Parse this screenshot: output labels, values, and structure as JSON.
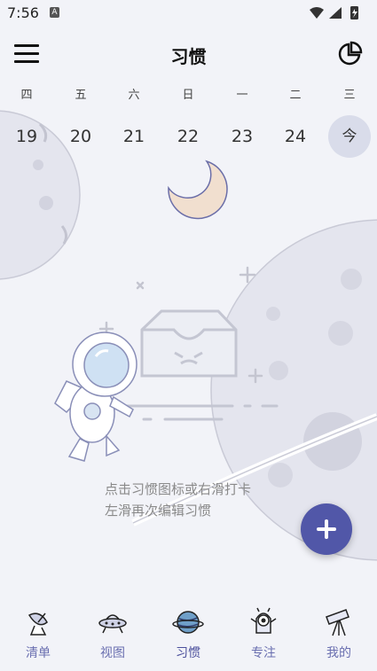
{
  "status_bar": {
    "time": "7:56",
    "notification_icon": "A"
  },
  "app_bar": {
    "title": "习惯"
  },
  "week": {
    "days": [
      "四",
      "五",
      "六",
      "日",
      "一",
      "二",
      "三"
    ],
    "dates": [
      "19",
      "20",
      "21",
      "22",
      "23",
      "24",
      "今"
    ]
  },
  "empty_state": {
    "line1": "点击习惯图标或右滑打卡",
    "line2": "左滑再次编辑习惯"
  },
  "tabs": [
    {
      "label": "清单",
      "icon": "satellite-dish-icon"
    },
    {
      "label": "视图",
      "icon": "ufo-icon"
    },
    {
      "label": "习惯",
      "icon": "planet-icon"
    },
    {
      "label": "专注",
      "icon": "alien-icon"
    },
    {
      "label": "我的",
      "icon": "telescope-icon"
    }
  ],
  "colors": {
    "accent": "#5157a8",
    "today_bg": "#d9dcea",
    "background": "#f2f3f8"
  }
}
